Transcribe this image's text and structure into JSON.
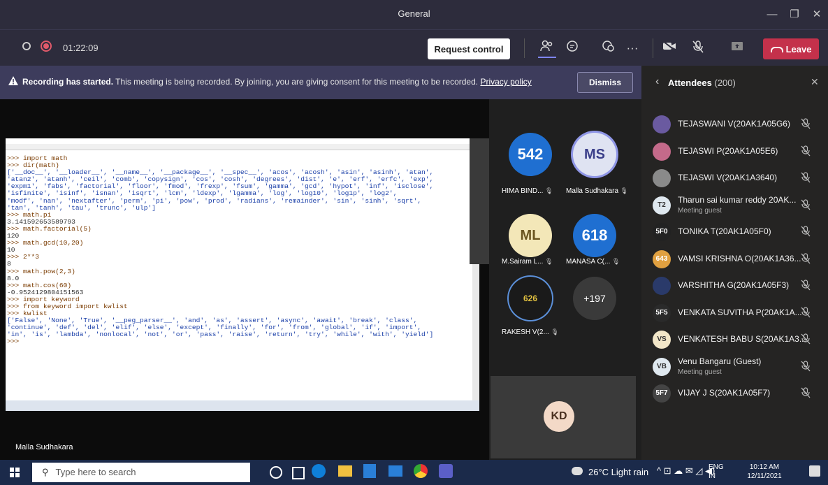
{
  "window": {
    "title": "General",
    "minimize": "—",
    "maximize": "❐",
    "close": "✕"
  },
  "controls": {
    "timer": "01:22:09",
    "request_control": "Request control",
    "leave": "Leave",
    "more": "···"
  },
  "banner": {
    "bold": "Recording has started.",
    "text": " This meeting is being recorded. By joining, you are giving consent for this meeting to be recorded. ",
    "link": "Privacy policy",
    "dismiss": "Dismiss"
  },
  "attendees": {
    "title": "Attendees",
    "count": "(200)",
    "list": [
      {
        "name": "TEJASWANI V(20AK1A05G6)",
        "sub": "",
        "avatar": "",
        "color": "#6a5aa0"
      },
      {
        "name": "TEJASWI P(20AK1A05E6)",
        "sub": "",
        "avatar": "",
        "color": "#c46a8a"
      },
      {
        "name": "TEJASWI V(20AK1A3640)",
        "sub": "",
        "avatar": "",
        "color": "#8a8a8a"
      },
      {
        "name": "Tharun sai kumar reddy 20AK...",
        "sub": "Meeting guest",
        "avatar": "T2",
        "color": "#dfe8ef"
      },
      {
        "name": "TONIKA T(20AK1A05F0)",
        "sub": "",
        "avatar": "5F0",
        "color": "#222222"
      },
      {
        "name": "VAMSI KRISHNA O(20AK1A36...",
        "sub": "",
        "avatar": "643",
        "color": "#e0a040"
      },
      {
        "name": "VARSHITHA G(20AK1A05F3)",
        "sub": "",
        "avatar": "",
        "color": "#2a3a6a"
      },
      {
        "name": "VENKATA SUVITHA P(20AK1A...",
        "sub": "",
        "avatar": "5F5",
        "color": "#2a2a2a"
      },
      {
        "name": "VENKATESH BABU S(20AK1A3...",
        "sub": "",
        "avatar": "VS",
        "color": "#f2e6c8"
      },
      {
        "name": "Venu Bangaru (Guest)",
        "sub": "Meeting guest",
        "avatar": "VB",
        "color": "#dfe8ef"
      },
      {
        "name": "VIJAY J S(20AK1A05F7)",
        "sub": "",
        "avatar": "5F7",
        "color": "#444444"
      }
    ]
  },
  "tiles": [
    {
      "name": "HIMA BIND...",
      "avatar": "542",
      "bg": "#1f6fd1",
      "fg": "#ffffff"
    },
    {
      "name": "Malla Sudhakara",
      "avatar": "MS",
      "bg": "#dfe3f2",
      "fg": "#3b3f8a"
    },
    {
      "name": "M.Sairam L...",
      "avatar": "ML",
      "bg": "#f3e7b8",
      "fg": "#6a5520"
    },
    {
      "name": "MANASA C(...",
      "avatar": "618",
      "bg": "#1f6fd1",
      "fg": "#ffffff"
    },
    {
      "name": "RAKESH V(2...",
      "avatar": "626",
      "bg": "#1a1a1a",
      "fg": "#e0c040"
    },
    {
      "name": "",
      "avatar": "+197",
      "bg": "#3a3a3a",
      "fg": "#ffffff"
    }
  ],
  "kd": {
    "avatar": "KD"
  },
  "presenter": "Malla Sudhakara",
  "shell": {
    "code": [
      ">>> import math",
      ">>> dir(math)",
      "['__doc__', '__loader__', '__name__', '__package__', '__spec__', 'acos', 'acosh', 'asin', 'asinh', 'atan',",
      "'atan2', 'atanh', 'ceil', 'comb', 'copysign', 'cos', 'cosh', 'degrees', 'dist', 'e', 'erf', 'erfc', 'exp',",
      "'expm1', 'fabs', 'factorial', 'floor', 'fmod', 'frexp', 'fsum', 'gamma', 'gcd', 'hypot', 'inf', 'isclose',",
      "'isfinite', 'isinf', 'isnan', 'isqrt', 'lcm', 'ldexp', 'lgamma', 'log', 'log10', 'log1p', 'log2',",
      "'modf', 'nan', 'nextafter', 'perm', 'pi', 'pow', 'prod', 'radians', 'remainder', 'sin', 'sinh', 'sqrt',",
      "'tan', 'tanh', 'tau', 'trunc', 'ulp']",
      ">>> math.pi",
      "3.141592653589793",
      ">>> math.factorial(5)",
      "120",
      ">>> math.gcd(10,20)",
      "10",
      ">>> 2**3",
      "8",
      ">>> math.pow(2,3)",
      "8.0",
      ">>> math.cos(60)",
      "-0.9524129804151563",
      ">>> import keyword",
      ">>> from keyword import kwlist",
      ">>> kwlist",
      "['False', 'None', 'True', '__peg_parser__', 'and', 'as', 'assert', 'async', 'await', 'break', 'class',",
      "'continue', 'def', 'del', 'elif', 'else', 'except', 'finally', 'for', 'from', 'global', 'if', 'import',",
      "'in', 'is', 'lambda', 'nonlocal', 'not', 'or', 'pass', 'raise', 'return', 'try', 'while', 'with', 'yield']",
      ">>>"
    ]
  },
  "taskbar": {
    "search": "Type here to search",
    "weather": "26°C  Light rain",
    "lang1": "ENG",
    "lang2": "IN",
    "time": "10:12 AM",
    "date": "12/11/2021"
  }
}
